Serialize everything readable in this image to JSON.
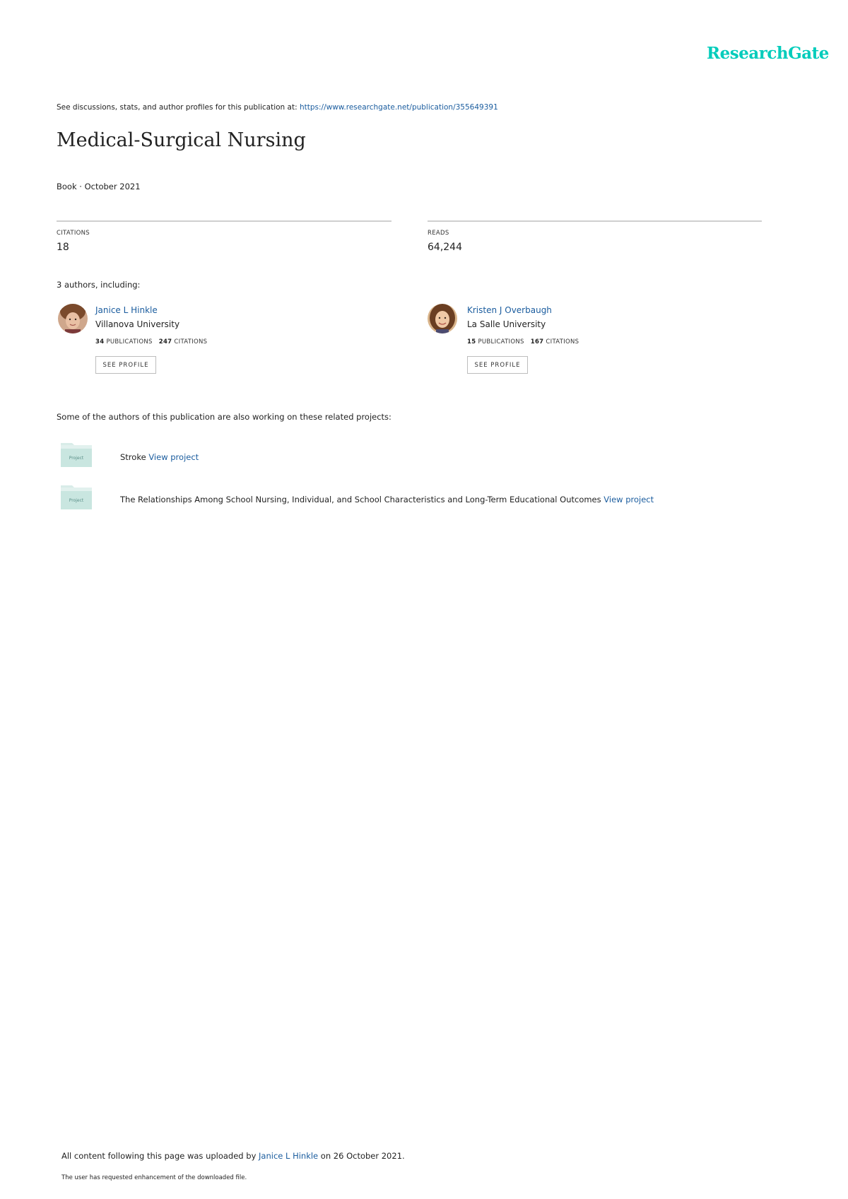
{
  "header": {
    "logo": "ResearchGate",
    "see_discussions_prefix": "See discussions, stats, and author profiles for this publication at:",
    "publication_url": "https://www.researchgate.net/publication/355649391"
  },
  "publication": {
    "title": "Medical-Surgical Nursing",
    "meta": "Book · October 2021"
  },
  "stats": {
    "citations_label": "CITATIONS",
    "citations_value": "18",
    "reads_label": "READS",
    "reads_value": "64,244"
  },
  "authors": {
    "heading": "3 authors, including:",
    "list": [
      {
        "name": "Janice L Hinkle",
        "institution": "Villanova University",
        "publications": "34",
        "publications_label": "PUBLICATIONS",
        "citations": "247",
        "citations_label": "CITATIONS",
        "button": "SEE PROFILE"
      },
      {
        "name": "Kristen J Overbaugh",
        "institution": "La Salle University",
        "publications": "15",
        "publications_label": "PUBLICATIONS",
        "citations": "167",
        "citations_label": "CITATIONS",
        "button": "SEE PROFILE"
      }
    ]
  },
  "projects": {
    "heading": "Some of the authors of this publication are also working on these related projects:",
    "icon_label": "Project",
    "list": [
      {
        "name": "Stroke",
        "link": "View project"
      },
      {
        "name": "The Relationships Among School Nursing, Individual, and School Characteristics and Long-Term Educational Outcomes",
        "link": "View project"
      }
    ]
  },
  "footer": {
    "upload_prefix": "All content following this page was uploaded by",
    "uploader": "Janice L Hinkle",
    "upload_suffix": "on 26 October 2021.",
    "note": "The user has requested enhancement of the downloaded file."
  },
  "colors": {
    "brand": "#00ccbb",
    "link": "#1a5c9e",
    "rule": "#cfcfcf"
  }
}
